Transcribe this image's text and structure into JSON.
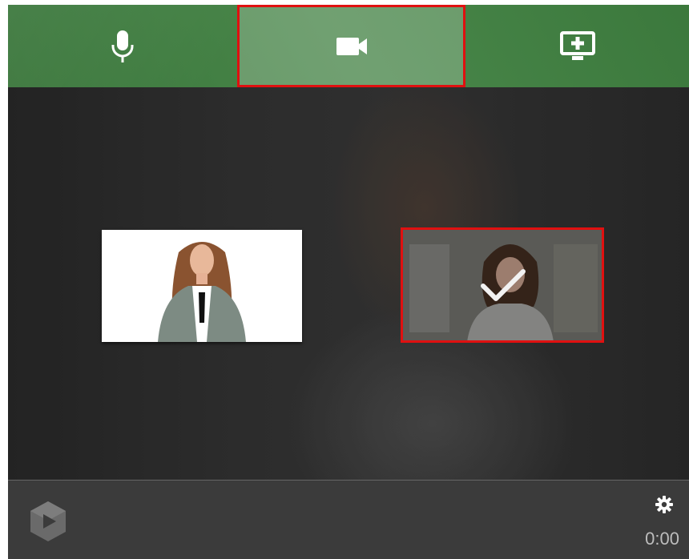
{
  "toolbar": {
    "tabs": [
      {
        "id": "mic",
        "icon": "microphone-icon",
        "selected": false
      },
      {
        "id": "camera",
        "icon": "video-camera-icon",
        "selected": true
      },
      {
        "id": "screen",
        "icon": "add-screen-icon",
        "selected": false
      }
    ],
    "selected_outline_color": "#e01010",
    "background_color": "#3f8040"
  },
  "stage": {
    "camera_options": [
      {
        "id": "camera-1",
        "selected": false
      },
      {
        "id": "camera-2",
        "selected": true,
        "icon": "checkmark-icon"
      }
    ]
  },
  "bottombar": {
    "logo": "panopto-logo-icon",
    "settings_icon": "gear-icon",
    "timer": "0:00"
  }
}
